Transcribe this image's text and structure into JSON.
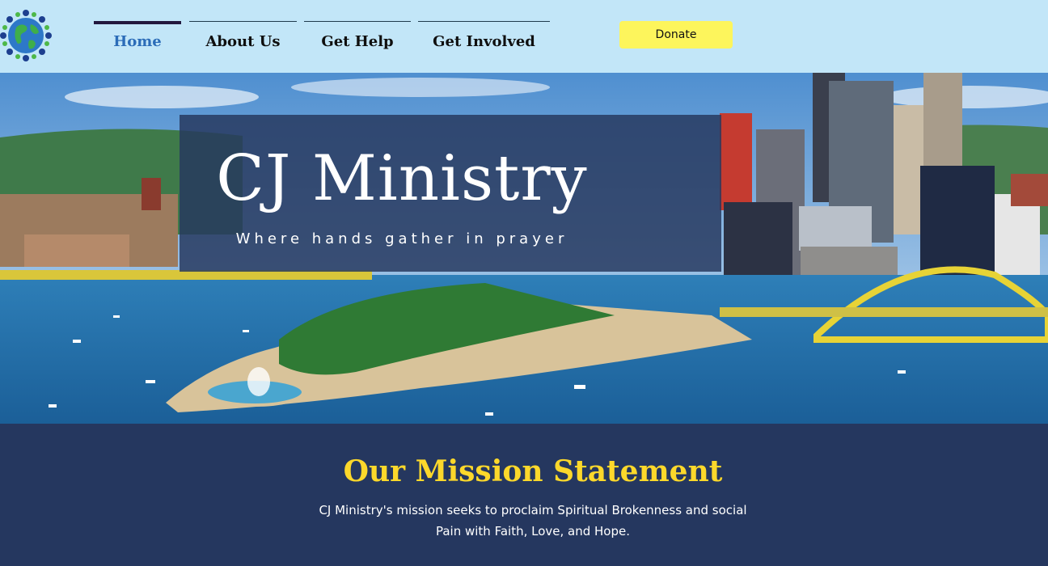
{
  "header": {
    "logo_icon": "globe-people-icon",
    "nav": [
      {
        "label": "Home",
        "active": true
      },
      {
        "label": "About Us",
        "active": false
      },
      {
        "label": "Get Help",
        "active": false
      },
      {
        "label": "Get Involved",
        "active": false
      }
    ],
    "donate_label": "Donate"
  },
  "hero": {
    "title": "CJ Ministry",
    "subtitle": "Where hands gather in prayer"
  },
  "mission": {
    "title": "Our Mission Statement",
    "text": "CJ Ministry's mission seeks to proclaim Spiritual Brokenness and social Pain with Faith, Love, and Hope."
  },
  "colors": {
    "header_bg": "#c2e6f8",
    "accent_yellow": "#fdf55c",
    "mission_bg": "#25375f",
    "mission_title": "#fcd82b",
    "active_nav": "#2b6cb8"
  }
}
